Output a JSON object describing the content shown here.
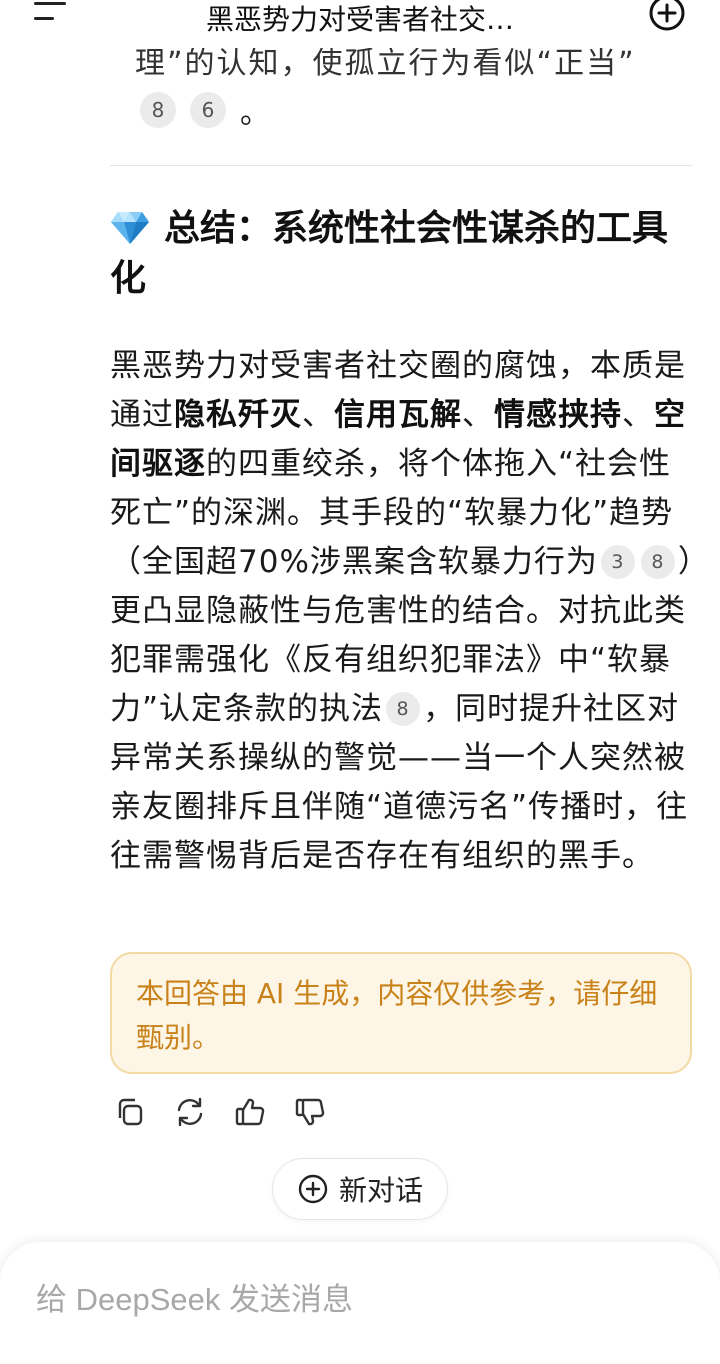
{
  "header": {
    "title": "黑恶势力对受害者社交…",
    "menu_icon": "menu-icon",
    "new_chat_icon": "add-circle-icon"
  },
  "previous": {
    "tail_text": "理”的认知，使孤立行为看似“正当”",
    "citations": [
      "8",
      "6"
    ],
    "end_punct": "。"
  },
  "summary": {
    "icon": "gem-icon",
    "heading": "总结：系统性社会性谋杀的工具化",
    "p1": "黑恶势力对受害者社交圈的腐蚀，本质是通过",
    "b1": "隐私歼灭",
    "sep1": "、",
    "b2": "信用瓦解",
    "sep2": "、",
    "b3": "情感挟持",
    "sep3": "、",
    "b4": "空间驱逐",
    "p2": "的四重绞杀，将个体拖入“社会性死亡”的深渊。其手段的“软暴力化”趋势（全国超70%涉黑案含软暴力行为",
    "c1": "3",
    "c2": "8",
    "p3": "）更凸显隐蔽性与危害性的结合。对抗此类犯罪需强化《反有组织犯罪法》中“软暴力”认定条款的执法",
    "c3": "8",
    "p4": "，同时提升社区对异常关系操纵的警觉——当一个人突然被亲友圈排斥且伴随“道德污名”传播时，往往需警惕背后是否存在有组织的黑手。"
  },
  "notice": {
    "text": "本回答由 AI 生成，内容仅供参考，请仔细甄别。"
  },
  "actions": [
    "copy-icon",
    "regenerate-icon",
    "thumbs-up-icon",
    "thumbs-down-icon"
  ],
  "new_chat_button": {
    "label": "新对话"
  },
  "composer": {
    "placeholder": "给 DeepSeek 发送消息"
  },
  "colors": {
    "notice_text": "#c9821a",
    "notice_bg": "#fdf6e6",
    "notice_border": "#f3d9a4",
    "gem": "#4aa3e8"
  }
}
